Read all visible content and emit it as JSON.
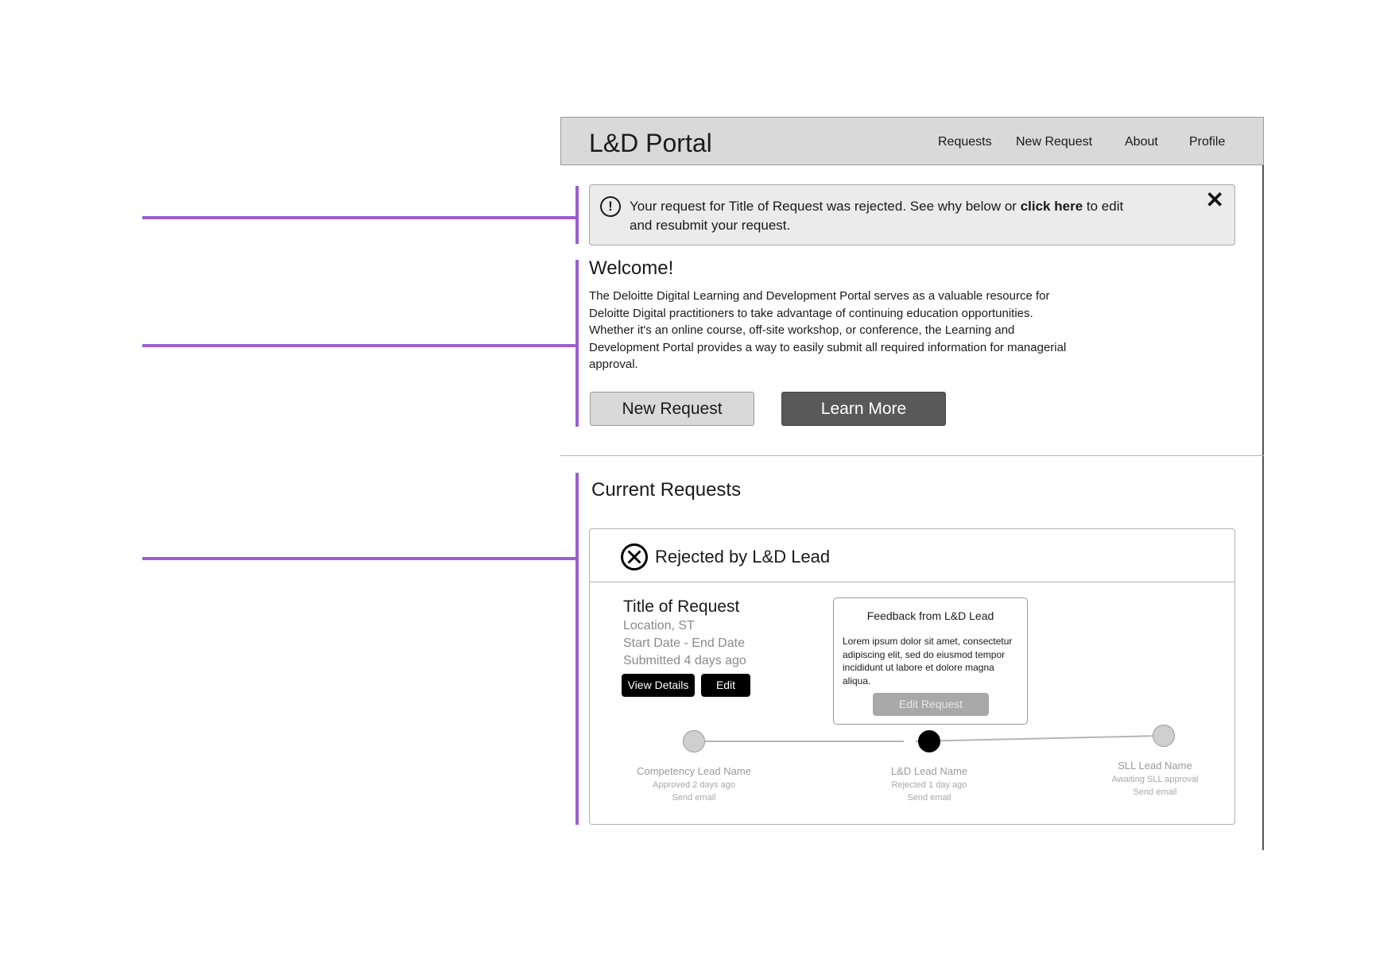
{
  "nav": {
    "brand": "L&D Portal",
    "links": [
      "Requests",
      "New Request",
      "About",
      "Profile"
    ]
  },
  "alert": {
    "icon": "exclamation-circle-icon",
    "text_before": "Your request for Title of Request was rejected. See why below or ",
    "link_text": "click here",
    "text_after": " to edit and resubmit your request.",
    "close": "✕"
  },
  "welcome": {
    "title": "Welcome!",
    "body": "The Deloitte Digital Learning and Development Portal serves as a valuable resource for Deloitte Digital practitioners to take advantage of continuing education opportunities. Whether it's an online course, off-site workshop, or conference, the Learning and Development Portal provides a way to easily submit all required information for managerial approval.",
    "new_request_label": "New Request",
    "learn_more_label": "Learn More"
  },
  "current": {
    "title": "Current Requests",
    "card": {
      "status_icon": "x-circle-icon",
      "status": "Rejected by L&D Lead",
      "request_title": "Title of Request",
      "location": "Location, ST",
      "dates": "Start Date - End Date",
      "submitted": "Submitted 4 days ago",
      "view_details_label": "View Details",
      "edit_label": "Edit",
      "feedback": {
        "title": "Feedback from L&D Lead",
        "body": "Lorem ipsum dolor sit amet, consectetur adipiscing elit, sed do eiusmod tempor incididunt ut labore et dolore magna aliqua.",
        "button_label": "Edit Request"
      },
      "steps": [
        {
          "name": "Competency Lead Name",
          "status": "Approved 2 days ago",
          "action": "Send email"
        },
        {
          "name": "L&D Lead Name",
          "status": "Rejected 1 day ago",
          "action": "Send email"
        },
        {
          "name": "SLL Lead Name",
          "status": "Awaiting SLL approval",
          "action": "Send email"
        }
      ]
    }
  },
  "colors": {
    "annotation": "#9b5fd0",
    "navbar_bg": "#d9d9d9",
    "primary_dark_button": "#595959",
    "step_complete": "#cfcfcf",
    "step_active": "#000000"
  }
}
